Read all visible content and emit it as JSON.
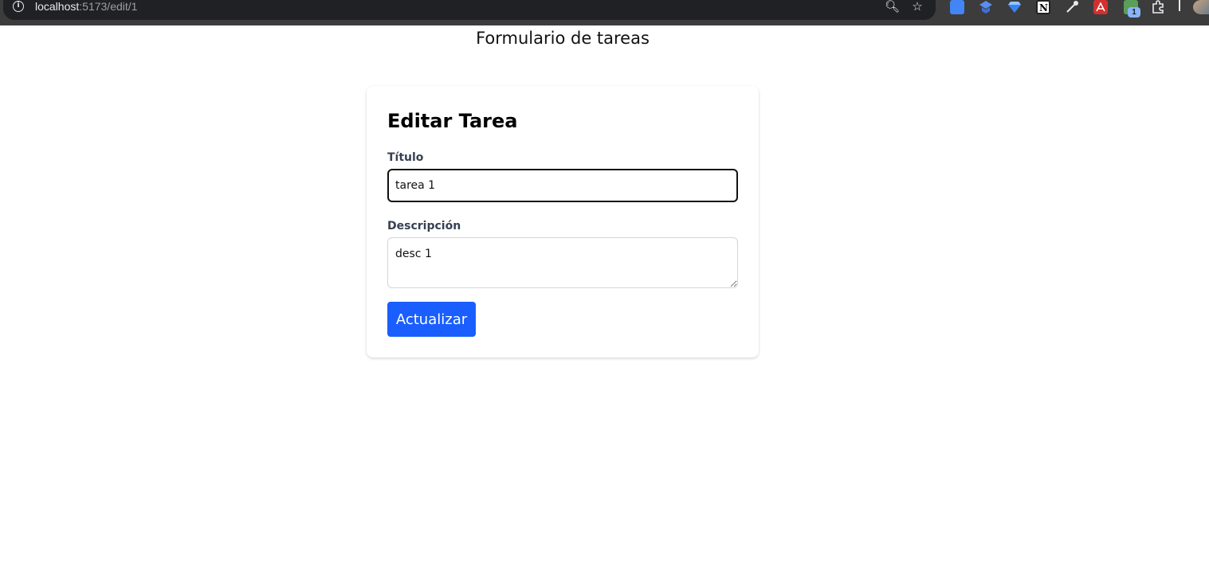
{
  "browser": {
    "url_host": "localhost",
    "url_path": ":5173/edit/1",
    "extensions": [
      {
        "icon": "google-translate-icon",
        "color": "#4285f4"
      },
      {
        "icon": "extension-blue-icon",
        "color": "#5b8def"
      },
      {
        "icon": "diamond-icon",
        "color": "#3b82f6"
      },
      {
        "icon": "notion-icon",
        "color": "#ffffff"
      },
      {
        "icon": "eyedropper-icon",
        "color": "#e8eaed"
      },
      {
        "icon": "pdf-icon",
        "color": "#d32f2f"
      },
      {
        "icon": "extension-green-icon",
        "color": "#5a9e5a"
      }
    ],
    "badge_count": "1"
  },
  "page": {
    "title": "Formulario de tareas"
  },
  "form": {
    "heading": "Editar Tarea",
    "title_label": "Título",
    "title_value": "tarea 1",
    "description_label": "Descripción",
    "description_value": "desc 1",
    "submit_label": "Actualizar"
  },
  "colors": {
    "primary": "#1a5eff",
    "label": "#374151",
    "input_border": "#d1d5db",
    "browser_bar": "#3c3c3c"
  }
}
